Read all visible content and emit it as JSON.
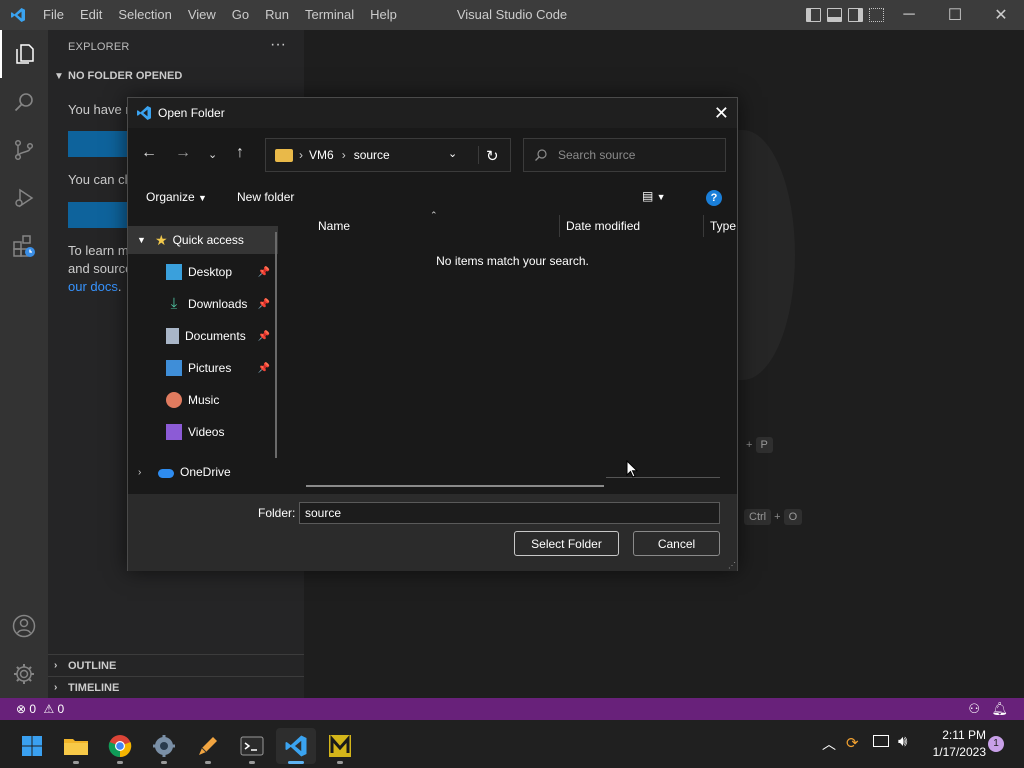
{
  "titlebar": {
    "menu": [
      "File",
      "Edit",
      "Selection",
      "View",
      "Go",
      "Run",
      "Terminal",
      "Help"
    ],
    "title": "Visual Studio Code",
    "window_controls": [
      "─",
      "☐",
      "✕"
    ]
  },
  "sidebar": {
    "header": "EXPLORER",
    "section": "NO FOLDER OPENED",
    "text1": "You have r",
    "text2": "You can clo",
    "text3_line1": "To learn m",
    "text3_line2": "and source",
    "text3_link": "our docs",
    "text3_tail": ".",
    "outline": "OUTLINE",
    "timeline": "TIMELINE"
  },
  "editor_hints": {
    "hint1_plus": "+",
    "hint1_key": "P",
    "hint2_key1": "Ctrl",
    "hint2_plus": "+",
    "hint2_key2": "O"
  },
  "dialog": {
    "title": "Open Folder",
    "address": {
      "part1": "VM6",
      "part2": "source"
    },
    "search_placeholder": "Search source",
    "toolbar": {
      "organize": "Organize",
      "new_folder": "New folder"
    },
    "nav": [
      {
        "label": "Quick access",
        "pinned": false
      },
      {
        "label": "Desktop",
        "pinned": true
      },
      {
        "label": "Downloads",
        "pinned": true
      },
      {
        "label": "Documents",
        "pinned": true
      },
      {
        "label": "Pictures",
        "pinned": true
      },
      {
        "label": "Music",
        "pinned": false
      },
      {
        "label": "Videos",
        "pinned": false
      },
      {
        "label": "OneDrive",
        "pinned": false
      }
    ],
    "columns": [
      "Name",
      "Date modified",
      "Type"
    ],
    "empty_message": "No items match your search.",
    "folder_label": "Folder:",
    "folder_value": "source",
    "select_button": "Select Folder",
    "cancel_button": "Cancel"
  },
  "statusbar": {
    "errors": "0",
    "warnings": "0"
  },
  "taskbar": {
    "time": "2:11 PM",
    "date": "1/17/2023",
    "notification_count": "1"
  }
}
